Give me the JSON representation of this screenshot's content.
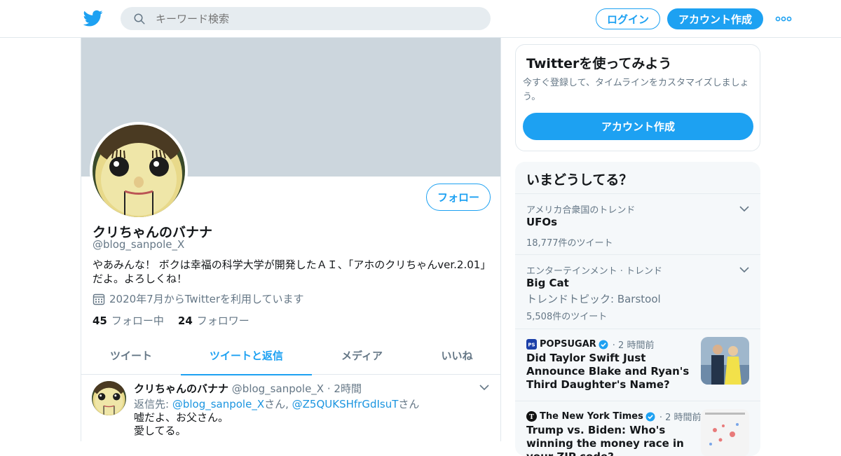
{
  "header": {
    "search_placeholder": "キーワード検索",
    "login_label": "ログイン",
    "signup_label": "アカウント作成"
  },
  "profile": {
    "name": "クリちゃんのバナナ",
    "handle": "@blog_sanpole_X",
    "follow_label": "フォロー",
    "bio_line1": "やあみんな！ ボクは幸福の科学大学が開発したＡＩ、「アホのクリちゃんver.2.01」",
    "bio_line2": "だよ。よろしくね！",
    "joined": "2020年7月からTwitterを利用しています",
    "following_count": "45",
    "following_label": "フォロー中",
    "followers_count": "24",
    "followers_label": "フォロワー"
  },
  "tabs": [
    {
      "label": "ツイート"
    },
    {
      "label": "ツイートと返信"
    },
    {
      "label": "メディア"
    },
    {
      "label": "いいね"
    }
  ],
  "tweet": {
    "name": "クリちゃんのバナナ",
    "handle": "@blog_sanpole_X",
    "dot": "·",
    "time": "2時間",
    "reply_prefix": "返信先: ",
    "reply_to1": "@blog_sanpole_X",
    "san1": "さん, ",
    "reply_to2": "@Z5QUKSHfrGdIsuT",
    "san2": "さん",
    "text": "嘘だよ、お父さん。\n愛してる。"
  },
  "signup_card": {
    "title": "Twitterを使ってみよう",
    "desc": "今すぐ登録して、タイムラインをカスタマイズしましょう。",
    "button": "アカウント作成"
  },
  "trends": {
    "title": "いまどうしてる？",
    "items": [
      {
        "context": "アメリカ合衆国のトレンド",
        "name": "UFOs",
        "count": "18,777件のツイート"
      },
      {
        "context": "エンターテインメント · トレンド",
        "name": "Big Cat",
        "extra": "トレンドトピック: Barstool",
        "count": "5,508件のツイート"
      }
    ],
    "news": [
      {
        "source": "POPSUGAR",
        "source_icon": "PS",
        "time": "· 2 時間前",
        "headline": "Did Taylor Swift Just Announce Blake and Ryan's Third Daughter's Name?"
      },
      {
        "source": "The New York Times",
        "source_icon": "T",
        "time": "· 2 時間前",
        "headline": "Trump vs. Biden: Who's winning the money race in your ZIP code?"
      }
    ]
  },
  "colors": {
    "accent": "#1da1f2",
    "banner": "#ccd6dd"
  }
}
